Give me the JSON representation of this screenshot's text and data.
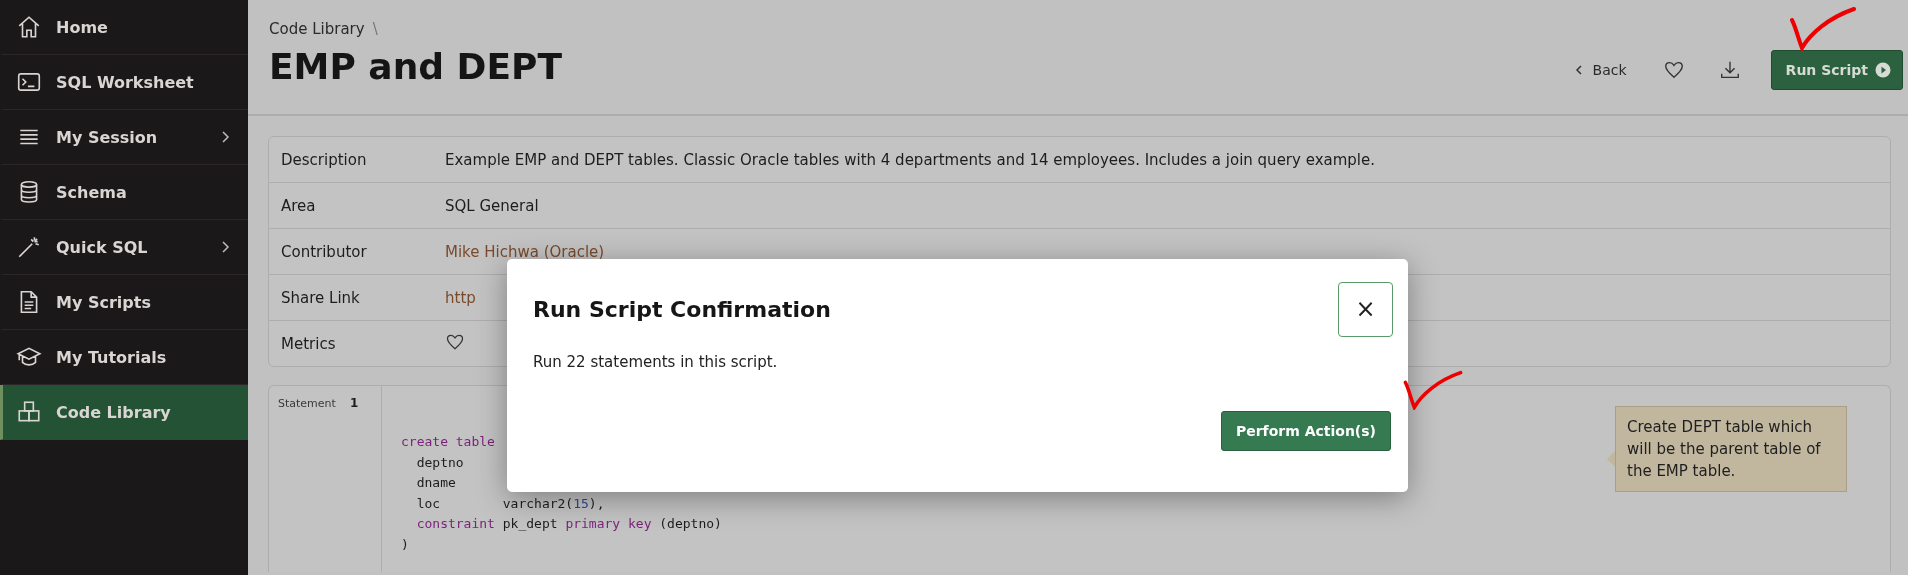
{
  "sidebar": {
    "items": [
      {
        "label": "Home",
        "kind": "home",
        "expandable": false,
        "selected": false
      },
      {
        "label": "SQL Worksheet",
        "kind": "terminal",
        "expandable": false,
        "selected": false
      },
      {
        "label": "My Session",
        "kind": "lines",
        "expandable": true,
        "selected": false
      },
      {
        "label": "Schema",
        "kind": "database",
        "expandable": false,
        "selected": false
      },
      {
        "label": "Quick SQL",
        "kind": "wand",
        "expandable": true,
        "selected": false
      },
      {
        "label": "My Scripts",
        "kind": "document",
        "expandable": false,
        "selected": false
      },
      {
        "label": "My Tutorials",
        "kind": "cap",
        "expandable": false,
        "selected": false
      },
      {
        "label": "Code Library",
        "kind": "blocks",
        "expandable": false,
        "selected": true
      }
    ]
  },
  "header": {
    "breadcrumb": "Code Library",
    "separator": "\\",
    "title": "EMP and DEPT",
    "back": "Back",
    "primary_button": "Run Script"
  },
  "details": [
    {
      "label": "Description",
      "value": "Example EMP and DEPT tables. Classic Oracle tables with 4 departments and 14 employees. Includes a join query example.",
      "kind": "text"
    },
    {
      "label": "Area",
      "value": "SQL General",
      "kind": "text"
    },
    {
      "label": "Contributor",
      "value": "Mike Hichwa (Oracle)",
      "kind": "link"
    },
    {
      "label": "Share Link",
      "value": "http",
      "kind": "link"
    },
    {
      "label": "Metrics",
      "kind": "likes"
    }
  ],
  "statement": {
    "label": "Statement",
    "number": "1",
    "lines": [
      [
        {
          "kind": "keyword",
          "text": "create table"
        }
      ],
      [
        {
          "kind": "plain",
          "text": "  deptno"
        }
      ],
      [
        {
          "kind": "plain",
          "text": "  dname"
        }
      ],
      [
        {
          "kind": "plain",
          "text": "  loc        varchar2("
        },
        {
          "kind": "number",
          "text": "15"
        },
        {
          "kind": "plain",
          "text": "),"
        }
      ],
      [
        {
          "kind": "keyword",
          "text": "  constraint"
        },
        {
          "kind": "plain",
          "text": " pk_dept "
        },
        {
          "kind": "keyword",
          "text": "primary key"
        },
        {
          "kind": "plain",
          "text": " (deptno)"
        }
      ],
      [
        {
          "kind": "plain",
          "text": ")"
        }
      ]
    ],
    "note": "Create DEPT table which will be the parent table of the EMP table."
  },
  "dialog": {
    "title": "Run Script Confirmation",
    "close": "×",
    "message": "Run 22 statements in this script.",
    "action": "Perform Action(s)"
  }
}
